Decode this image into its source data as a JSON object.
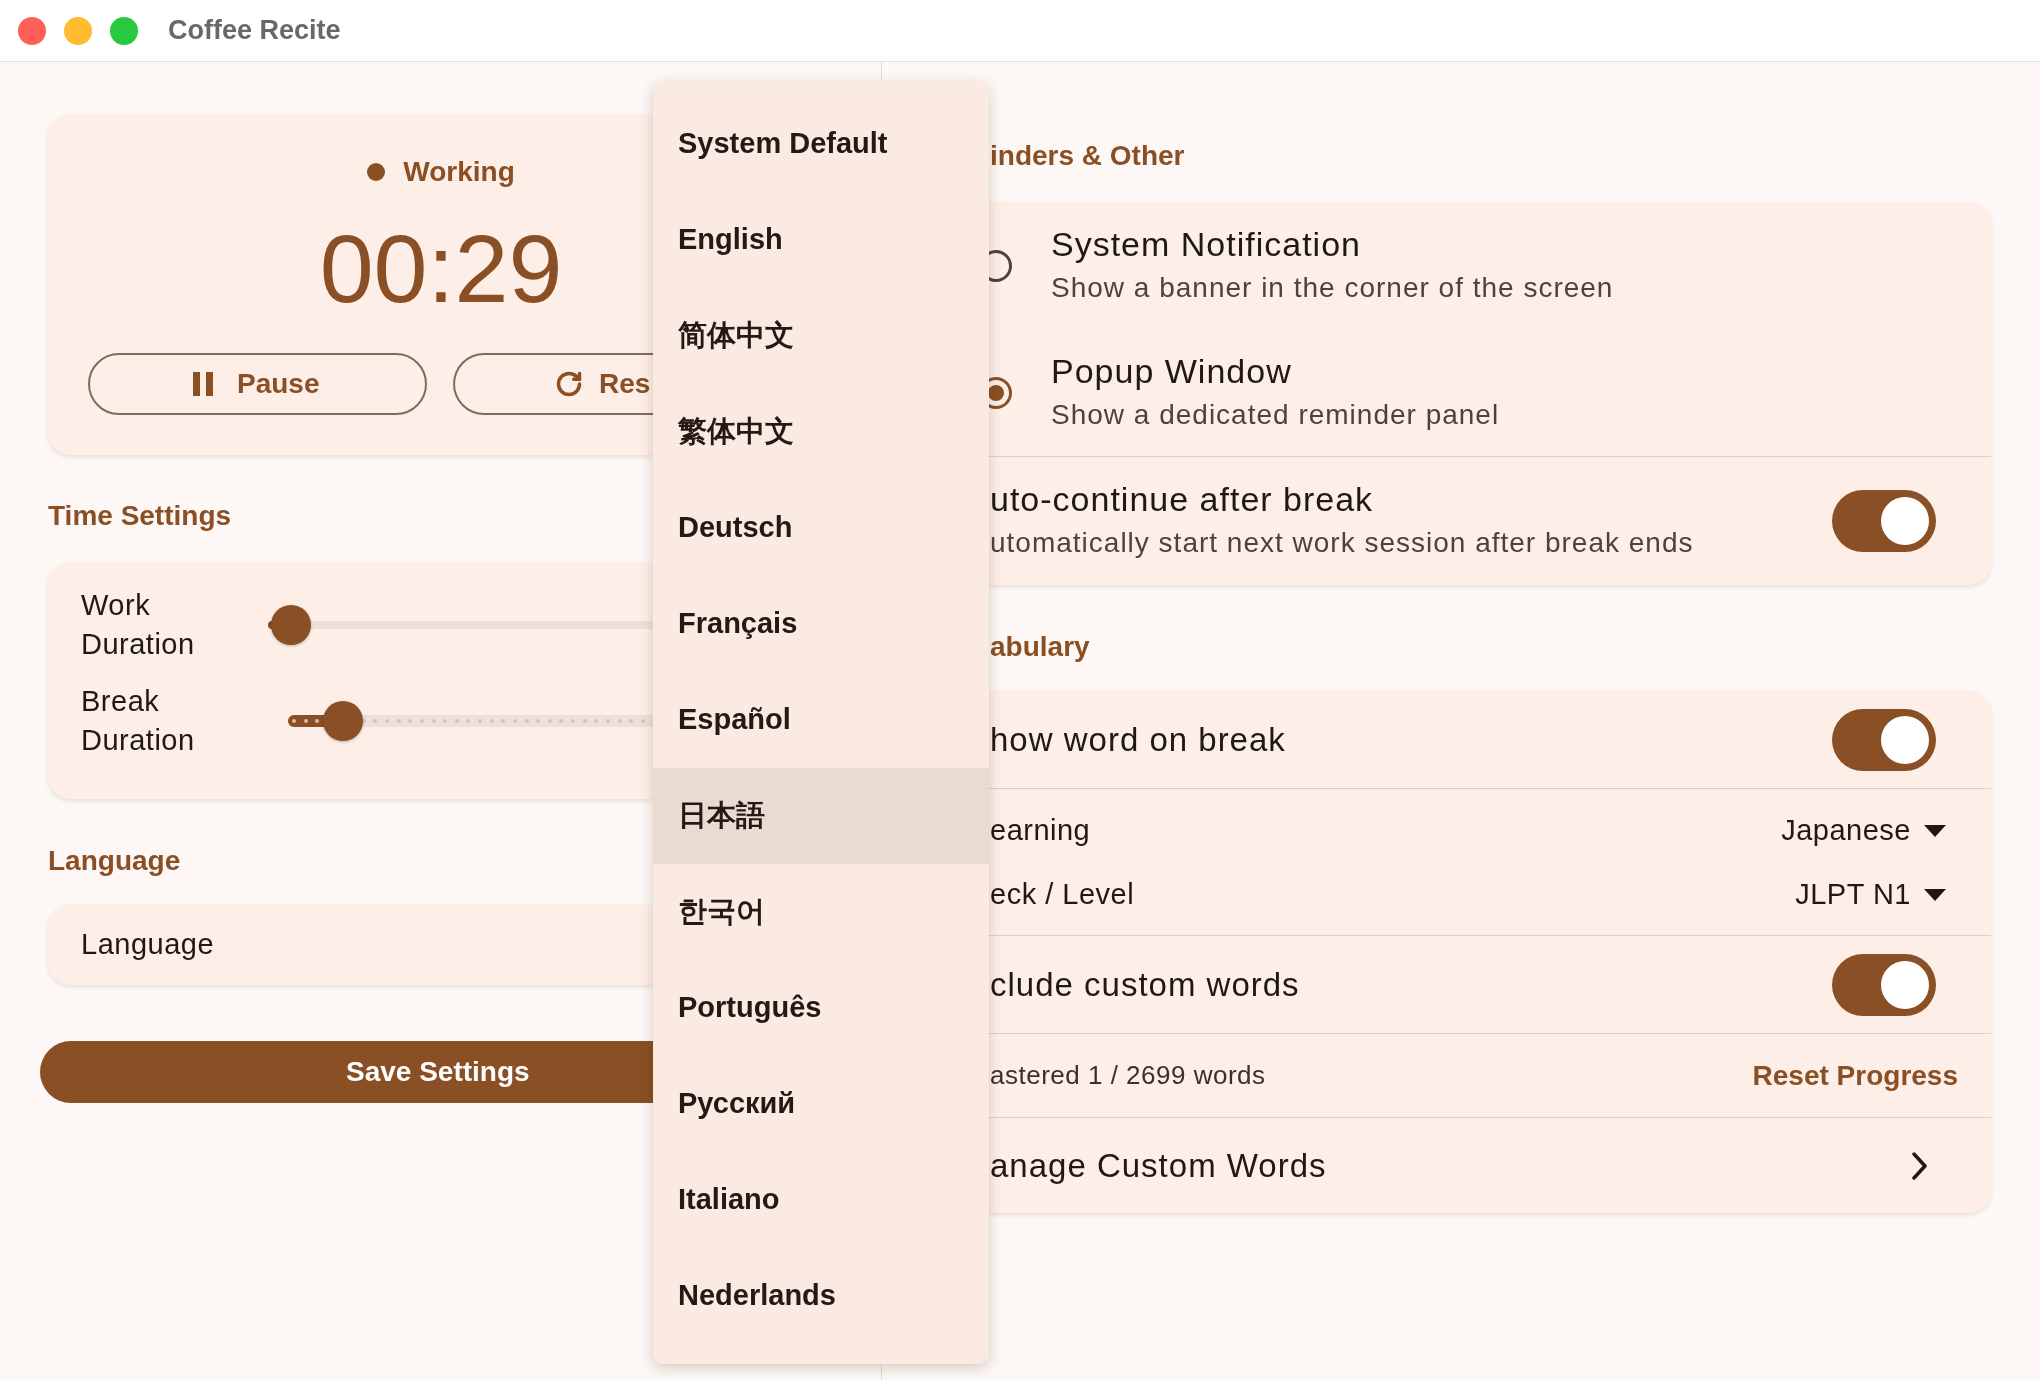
{
  "window": {
    "title": "Coffee Recite"
  },
  "timer": {
    "status": "Working",
    "time": "00:29",
    "buttons": [
      {
        "kind": "pause",
        "label": "Pause"
      },
      {
        "kind": "reset",
        "label": "Res"
      }
    ]
  },
  "time_settings": {
    "heading": "Time Settings",
    "sliders": [
      {
        "label": "Work Duration",
        "kind": "continuous",
        "level": 0.06
      },
      {
        "label": "Break Duration",
        "kind": "discrete",
        "level": 0.15
      }
    ]
  },
  "language": {
    "heading": "Language",
    "label": "Language"
  },
  "save_button": {
    "label": "Save Settings"
  },
  "language_menu": {
    "items": [
      {
        "label": "System Default",
        "selected": false
      },
      {
        "label": "English",
        "selected": false
      },
      {
        "label": "简体中文",
        "selected": false
      },
      {
        "label": "繁体中文",
        "selected": false
      },
      {
        "label": "Deutsch",
        "selected": false
      },
      {
        "label": "Français",
        "selected": false
      },
      {
        "label": "Español",
        "selected": false
      },
      {
        "label": "日本語",
        "selected": true
      },
      {
        "label": "한국어",
        "selected": false
      },
      {
        "label": "Português",
        "selected": false
      },
      {
        "label": "Русский",
        "selected": false
      },
      {
        "label": "Italiano",
        "selected": false
      },
      {
        "label": "Nederlands",
        "selected": false
      }
    ]
  },
  "reminders": {
    "heading": "inders & Other",
    "options": [
      {
        "title": "System Notification",
        "subtitle": "Show a banner in the corner of the screen",
        "selected": false
      },
      {
        "title": "Popup Window",
        "subtitle": "Show a dedicated reminder panel",
        "selected": true
      }
    ],
    "auto_continue": {
      "title": "uto-continue after break",
      "subtitle": "utomatically start next work session after break ends",
      "on": true
    }
  },
  "vocabulary": {
    "heading": "abulary",
    "groups": [
      [
        {
          "kind": "toggle",
          "label": "how word on break",
          "on": true
        }
      ],
      [
        {
          "kind": "select",
          "label": "earning",
          "value": "Japanese"
        },
        {
          "kind": "select",
          "label": "eck / Level",
          "value": "JLPT N1"
        }
      ],
      [
        {
          "kind": "toggle",
          "label": "clude custom words",
          "on": true
        }
      ],
      [
        {
          "kind": "stat",
          "label": "astered 1 / 2699 words",
          "action": "Reset Progress"
        }
      ],
      [
        {
          "kind": "link",
          "label": "anage Custom Words"
        }
      ]
    ]
  }
}
